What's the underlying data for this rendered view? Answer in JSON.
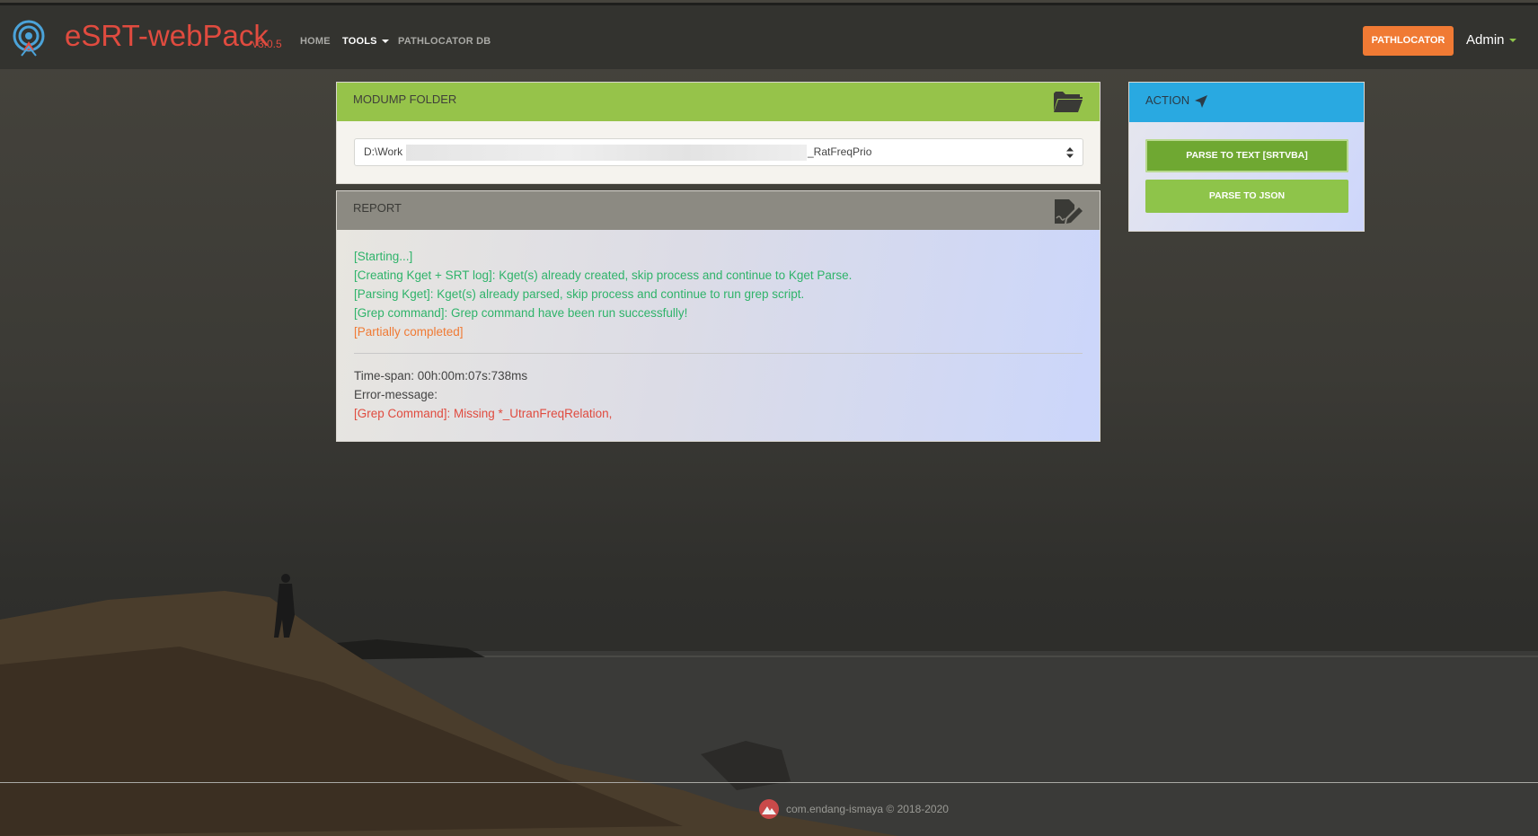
{
  "navbar": {
    "brand": "eSRT-webPack",
    "version": "v3.0.5",
    "items": [
      {
        "label": "HOME"
      },
      {
        "label": "TOOLS"
      },
      {
        "label": "PATHLOCATOR DB"
      }
    ],
    "pathlocator_label": "PATHLOCATOR",
    "user_label": "Admin"
  },
  "modump": {
    "title": "MODUMP FOLDER",
    "path_start": "D:\\Work",
    "path_end": "_RatFreqPrio"
  },
  "report": {
    "title": "REPORT",
    "lines": [
      "[Starting...]",
      "[Creating Kget + SRT log]: Kget(s) already created, skip process and continue to Kget Parse.",
      "[Parsing Kget]: Kget(s) already parsed, skip process and continue to run grep script.",
      "[Grep command]: Grep command have been run successfully!",
      "[Partially completed]"
    ],
    "timespan": "Time-span: 00h:00m:07s:738ms",
    "error_label": "Error-message:",
    "error_detail": "[Grep Command]: Missing *_UtranFreqRelation,"
  },
  "action": {
    "title": "ACTION",
    "buttons": [
      {
        "label": "PARSE TO TEXT [SRTVBA]"
      },
      {
        "label": "PARSE TO JSON"
      }
    ]
  },
  "footer": {
    "text": "com.endang-ismaya © 2018-2020"
  },
  "colors": {
    "brand": "#e04b3f",
    "success": "#2fb36a",
    "warning": "#f07a34",
    "modump_header": "#96c34a",
    "action_header": "#29a9e1",
    "report_header": "#8c8a82"
  },
  "icons": {
    "logo": "radar-icon",
    "modump": "folder-open-icon",
    "report": "edit-document-icon",
    "action": "paper-plane-icon",
    "footer": "avatar-icon"
  }
}
